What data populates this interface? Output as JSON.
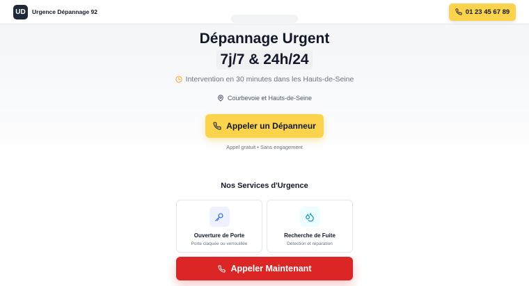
{
  "header": {
    "logo_text": "UD",
    "brand_name": "Urgence Dépannage 92",
    "phone": "01 23 45 67 89"
  },
  "hero": {
    "title_line1": "Dépannage Urgent",
    "title_line2": "7j/7 & 24h/24",
    "intervention_text": "Intervention en 30 minutes dans les Hauts-de-Seine",
    "location_text": "Courbevoie et Hauts-de-Seine",
    "cta_label": "Appeler un Dépanneur",
    "cta_note": "Appel gratuit • Sans engagement"
  },
  "services": {
    "title": "Nos Services d'Urgence",
    "items": [
      {
        "title": "Ouverture de Porte",
        "description": "Porte claquée ou verrouillée",
        "icon": "key-icon"
      },
      {
        "title": "Recherche de Fuite",
        "description": "Détection et réparation",
        "icon": "droplets-icon"
      }
    ]
  },
  "sticky_cta": {
    "label": "Appeler Maintenant"
  },
  "colors": {
    "accent_yellow": "#fcd34d",
    "danger_red": "#dc2626",
    "dark": "#1f2937"
  }
}
